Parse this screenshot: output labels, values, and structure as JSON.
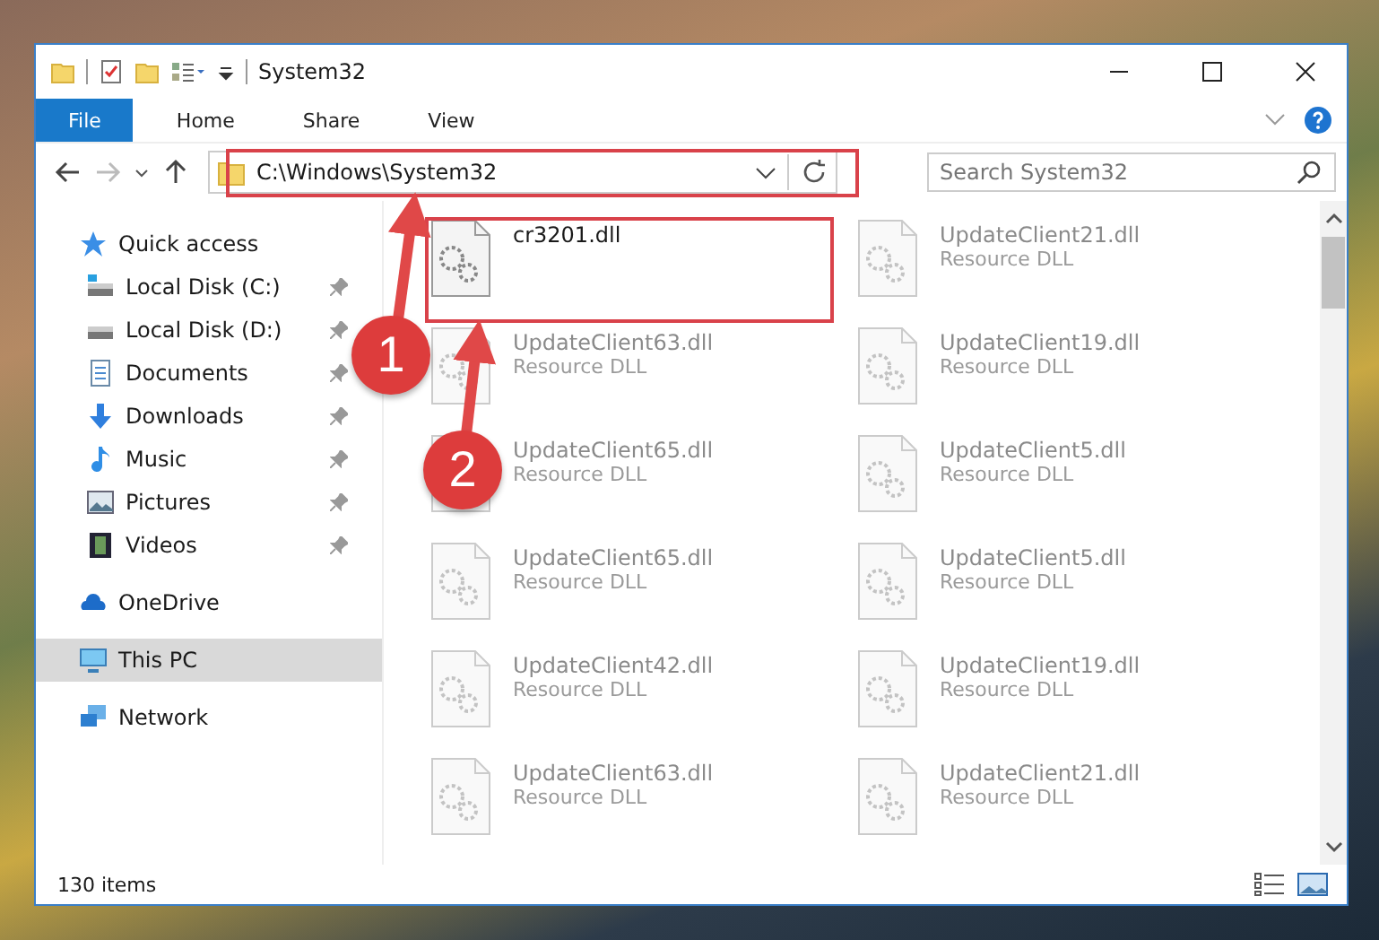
{
  "window": {
    "title": "System32"
  },
  "ribbon": {
    "tabs": [
      {
        "label": "File",
        "selected": true
      },
      {
        "label": "Home",
        "selected": false
      },
      {
        "label": "Share",
        "selected": false
      },
      {
        "label": "View",
        "selected": false
      }
    ]
  },
  "address_bar": {
    "path": "C:\\Windows\\System32"
  },
  "search": {
    "placeholder": "Search System32"
  },
  "sidebar": {
    "items": [
      {
        "label": "Quick access",
        "selected": false,
        "children": [
          {
            "label": "Local Disk (C:)",
            "pinned": true
          },
          {
            "label": "Local Disk (D:)",
            "pinned": true
          },
          {
            "label": "Documents",
            "pinned": true
          },
          {
            "label": "Downloads",
            "pinned": true
          },
          {
            "label": "Music",
            "pinned": true
          },
          {
            "label": "Pictures",
            "pinned": true
          },
          {
            "label": "Videos",
            "pinned": true
          }
        ]
      },
      {
        "label": "OneDrive",
        "selected": false
      },
      {
        "label": "This PC",
        "selected": true
      },
      {
        "label": "Network",
        "selected": false
      }
    ]
  },
  "files": [
    {
      "name": "cr3201.dll",
      "blurred": false
    },
    {
      "name": "UpdateClient21.dll",
      "type": "Resource DLL",
      "blurred": true
    },
    {
      "name": "UpdateClient63.dll",
      "type": "Resource DLL",
      "blurred": true
    },
    {
      "name": "UpdateClient19.dll",
      "type": "Resource DLL",
      "blurred": true
    },
    {
      "name": "UpdateClient65.dll",
      "type": "Resource DLL",
      "blurred": true
    },
    {
      "name": "UpdateClient5.dll",
      "type": "Resource DLL",
      "blurred": true
    },
    {
      "name": "UpdateClient65.dll",
      "type": "Resource DLL",
      "blurred": true
    },
    {
      "name": "UpdateClient5.dll",
      "type": "Resource DLL",
      "blurred": true
    },
    {
      "name": "UpdateClient42.dll",
      "type": "Resource DLL",
      "blurred": true
    },
    {
      "name": "UpdateClient19.dll",
      "type": "Resource DLL",
      "blurred": true
    },
    {
      "name": "UpdateClient63.dll",
      "type": "Resource DLL",
      "blurred": true
    },
    {
      "name": "UpdateClient21.dll",
      "type": "Resource DLL",
      "blurred": true
    }
  ],
  "status_bar": {
    "count": "130 items"
  },
  "annotations": [
    {
      "label": "1"
    },
    {
      "label": "2"
    }
  ]
}
